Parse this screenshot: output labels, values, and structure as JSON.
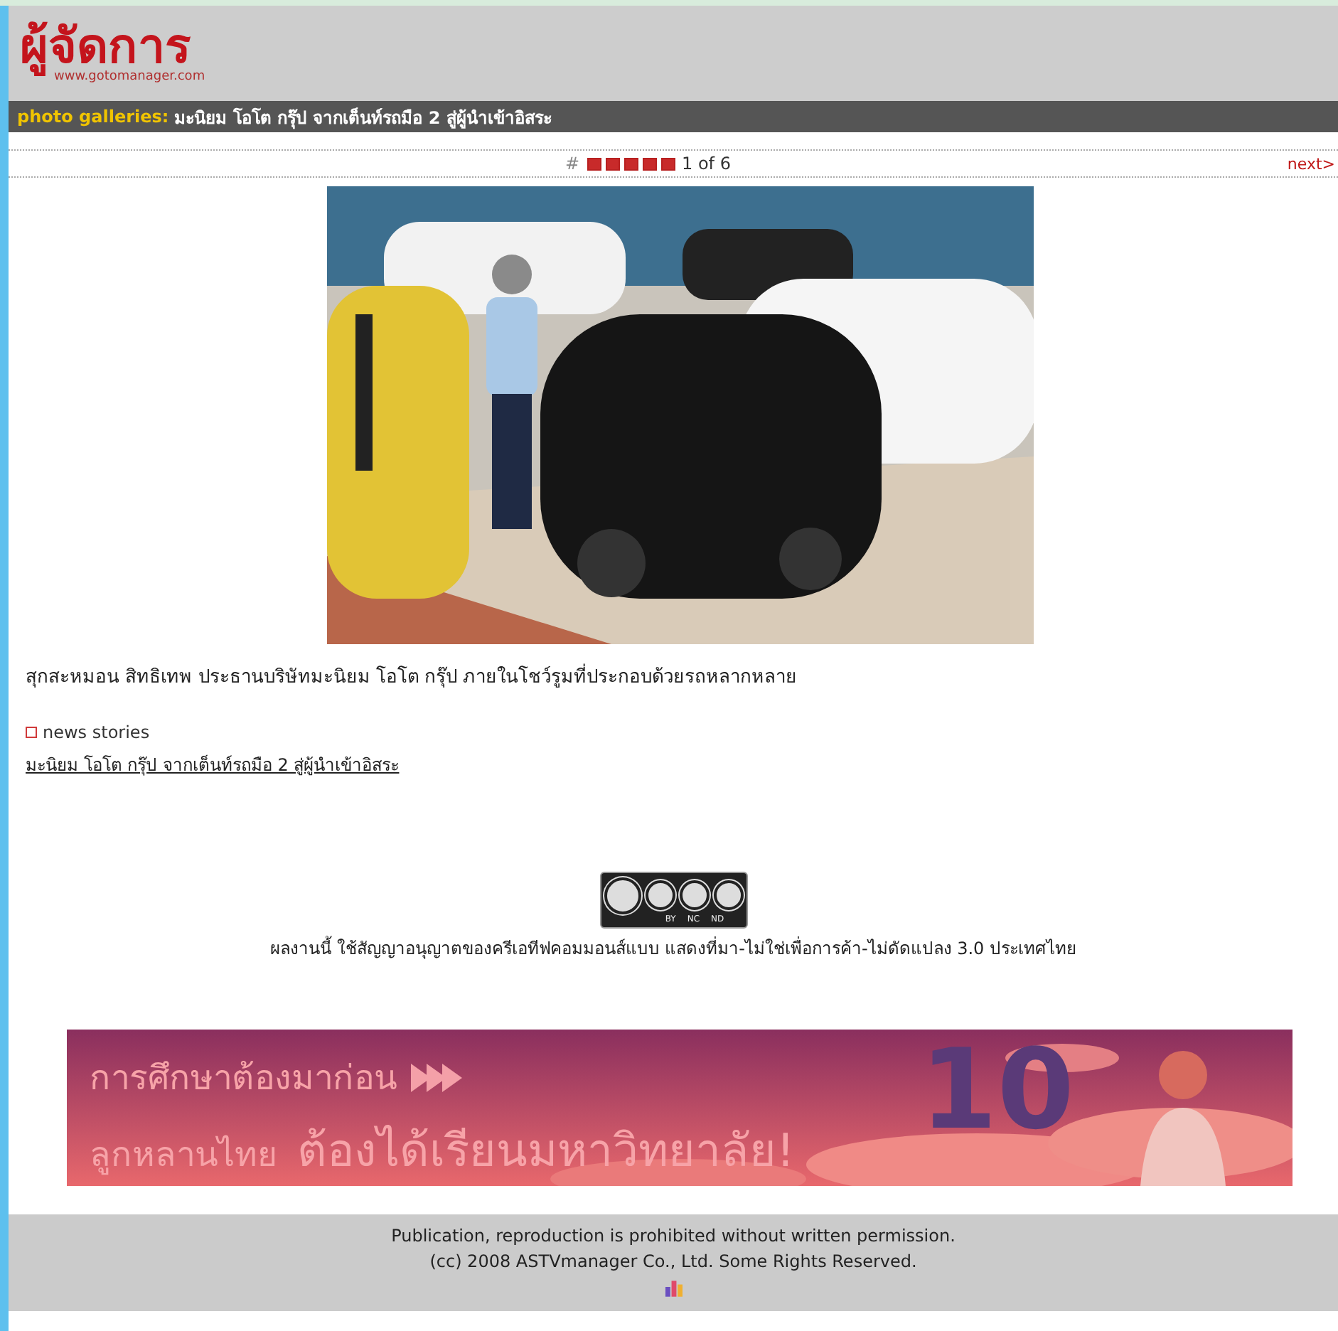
{
  "header": {
    "logo": "ผู้จัดการ",
    "logo_url": "www.gotomanager.com"
  },
  "gallery_bar": {
    "label": "photo galleries:",
    "title": "มะนิยม โอโต กรุ๊ป จากเต็นท์รถมือ 2 สู่ผู้นำเข้าอิสระ"
  },
  "pager": {
    "lead": "#",
    "pages": [
      {
        "selected": false
      },
      {
        "selected": false
      },
      {
        "selected": false
      },
      {
        "selected": false
      },
      {
        "selected": false
      }
    ],
    "position": "1 of 6",
    "next": "next>"
  },
  "caption": "สุกสะหมอน สิทธิเทพ ประธานบริษัทมะนิยม โอโต กรุ๊ป ภายในโชว์รูมที่ประกอบด้วยรถหลากหลาย",
  "news": {
    "heading": "news stories",
    "link": "มะนิยม โอโต กรุ๊ป จากเต็นท์รถมือ 2 สู่ผู้นำเข้าอิสระ"
  },
  "license": {
    "badge_labels": [
      "BY",
      "NC",
      "ND"
    ],
    "text": "ผลงานนี้ ใช้สัญญาอนุญาตของครีเอทีฟคอมมอนส์แบบ แสดงที่มา-ไม่ใช่เพื่อการค้า-ไม่ดัดแปลง 3.0 ประเทศไทย"
  },
  "banner": {
    "line_1": "การศึกษาต้องมาก่อน",
    "line_2a": "ลูกหลานไทย",
    "line_2b": "ต้องได้เรียนมหาวิทยาลัย!",
    "number": "10"
  },
  "footer": {
    "lines": [
      "Publication, reproduction is prohibited without written permission.",
      "(cc) 2008 ASTVmanager Co., Ltd. Some Rights Reserved."
    ]
  }
}
